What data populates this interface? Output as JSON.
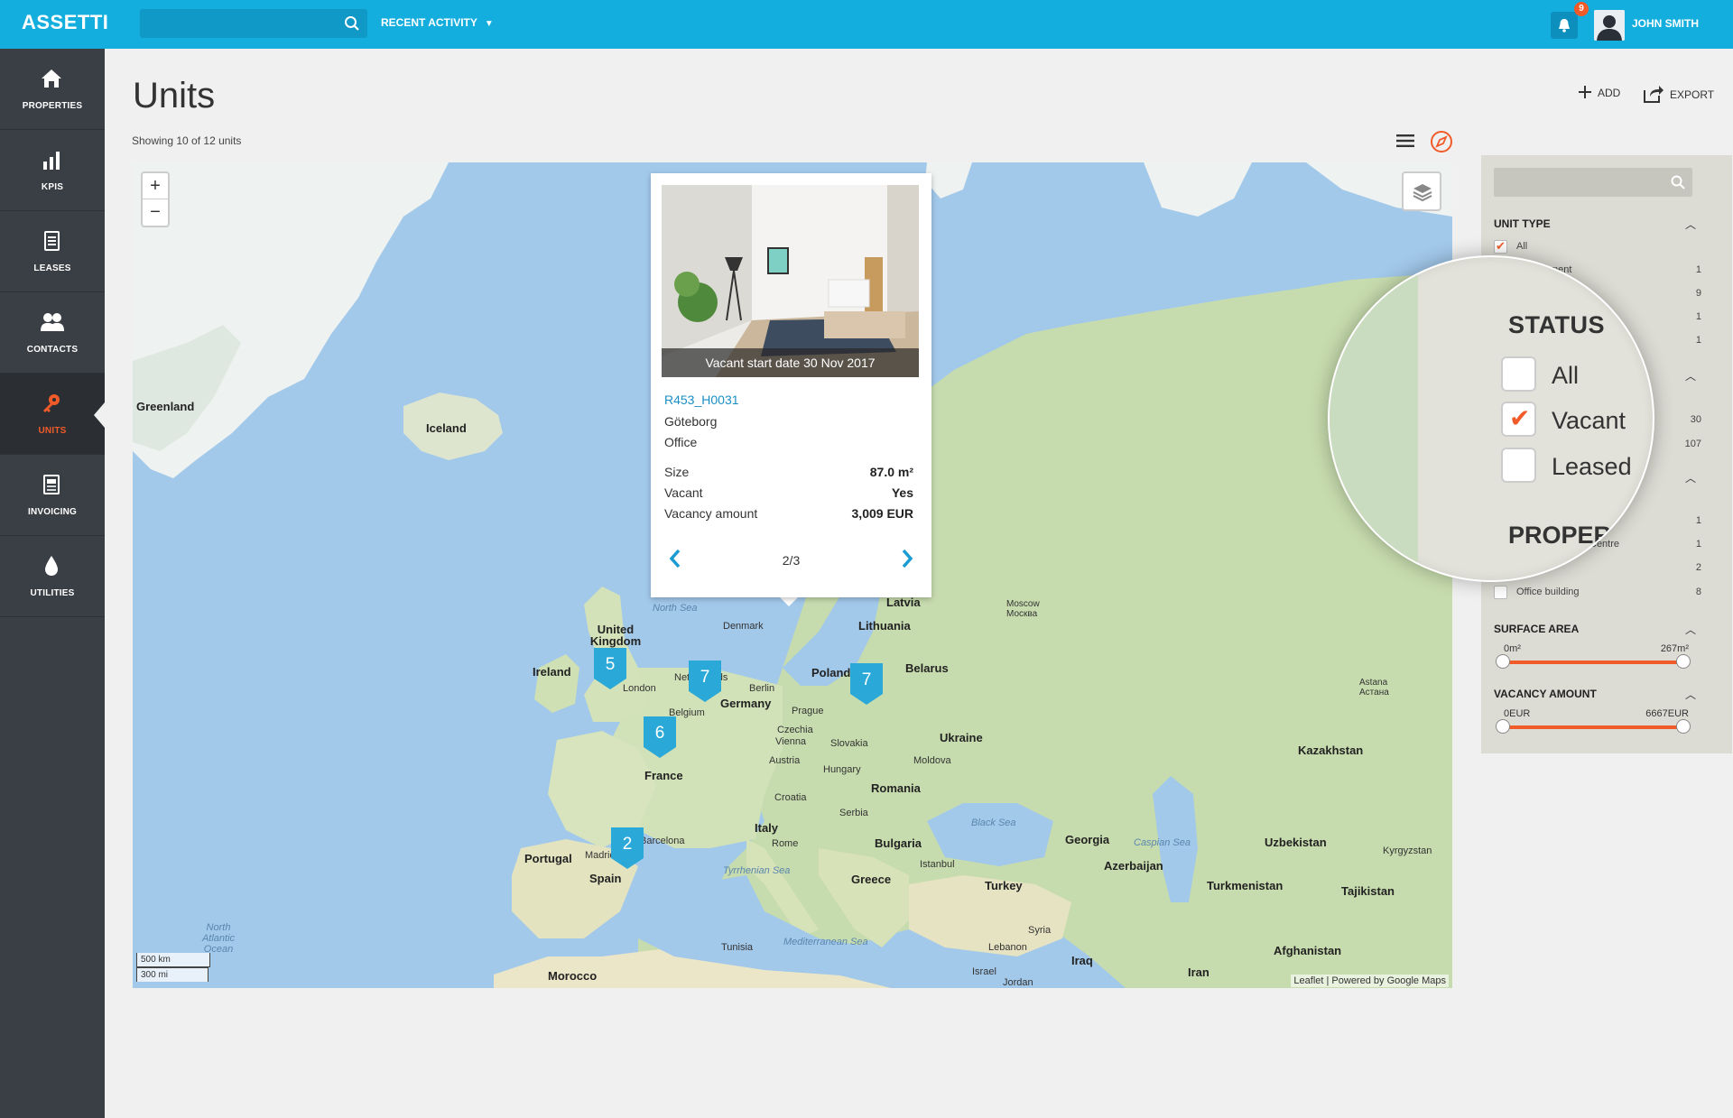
{
  "app": {
    "logo": "ASSETTI"
  },
  "topbar": {
    "recent_activity": "RECENT ACTIVITY",
    "notification_count": "9",
    "user_name": "JOHN SMITH"
  },
  "sidebar": {
    "items": [
      {
        "label": "PROPERTIES",
        "icon": "home-icon"
      },
      {
        "label": "KPIS",
        "icon": "bar-chart-icon"
      },
      {
        "label": "LEASES",
        "icon": "document-icon"
      },
      {
        "label": "CONTACTS",
        "icon": "contacts-icon"
      },
      {
        "label": "UNITS",
        "icon": "key-icon",
        "active": true
      },
      {
        "label": "INVOICING",
        "icon": "invoice-icon"
      },
      {
        "label": "UTILITIES",
        "icon": "drop-icon"
      }
    ]
  },
  "page": {
    "title": "Units",
    "subtitle": "Showing 10 of 12 units",
    "add_label": "ADD",
    "export_label": "EXPORT"
  },
  "map": {
    "zoom_in": "+",
    "zoom_out": "−",
    "scale_km": "500 km",
    "scale_mi": "300 mi",
    "attribution": "Leaflet | Powered by Google Maps",
    "markers": [
      "5",
      "7",
      "7",
      "6",
      "2"
    ],
    "labels": {
      "greenland": "Greenland",
      "iceland": "Iceland",
      "ireland": "Ireland",
      "uk": "United Kingdom",
      "london": "London",
      "netherlands": "Netherlands",
      "belgium": "Belgium",
      "france": "France",
      "spain": "Spain",
      "portugal": "Portugal",
      "madrid": "Madrid",
      "barcelona": "Barcelona",
      "germany": "Germany",
      "berlin": "Berlin",
      "denmark": "Denmark",
      "poland": "Poland",
      "czechia": "Czechia",
      "prague": "Prague",
      "vienna": "Vienna",
      "austria": "Austria",
      "slovakia": "Slovakia",
      "hungary": "Hungary",
      "croatia": "Croatia",
      "serbia": "Serbia",
      "italy": "Italy",
      "rome": "Rome",
      "romania": "Romania",
      "moldova": "Moldova",
      "ukraine": "Ukraine",
      "belarus": "Belarus",
      "lithuania": "Lithuania",
      "latvia": "Latvia",
      "moscow": "Moscow Москва",
      "bulgaria": "Bulgaria",
      "greece": "Greece",
      "istanbul": "Istanbul",
      "turkey": "Turkey",
      "georgia": "Georgia",
      "azerbaijan": "Azerbaijan",
      "kazakhstan": "Kazakhstan",
      "astana": "Astana Астана",
      "uzbekistan": "Uzbekistan",
      "kyrgyzstan": "Kyrgyzstan",
      "turkmenistan": "Turkmenistan",
      "tajikistan": "Tajikistan",
      "afghanistan": "Afghanistan",
      "iran": "Iran",
      "iraq": "Iraq",
      "syria": "Syria",
      "lebanon": "Lebanon",
      "israel": "Israel",
      "jordan": "Jordan",
      "tunisia": "Tunisia",
      "morocco": "Morocco",
      "north_sea": "North Sea",
      "black_sea": "Black Sea",
      "caspian_sea": "Caspian Sea",
      "tyrrhenian": "Tyrrhenian Sea",
      "mediterranean": "Mediterranean Sea",
      "atlantic": "North Atlantic Ocean"
    }
  },
  "popup": {
    "photo_caption": "Vacant start date 30 Nov 2017",
    "unit_id": "R453_H0031",
    "city": "Göteborg",
    "type": "Office",
    "rows": [
      {
        "key": "Size",
        "value": "87.0 m²"
      },
      {
        "key": "Vacant",
        "value": "Yes"
      },
      {
        "key": "Vacancy amount",
        "value": "3,009 EUR"
      }
    ],
    "page": "2/3",
    "close": "×"
  },
  "filters": {
    "unit_type_title": "UNIT TYPE",
    "unit_type_all": "All",
    "unit_type_partial": "ment",
    "unit_type_counts": [
      "1",
      "9",
      "1",
      "1"
    ],
    "status_counts": [
      "30",
      "107"
    ],
    "property_counts": [
      "1",
      "1",
      "2",
      "8"
    ],
    "property_partial": "Centre",
    "office_building": "Office building",
    "surface_title": "SURFACE AREA",
    "surface_min": "0m²",
    "surface_max": "267m²",
    "surface_range": [
      0,
      1
    ],
    "vacancy_title": "VACANCY AMOUNT",
    "vacancy_min": "0EUR",
    "vacancy_max": "6667EUR",
    "vacancy_range": [
      0,
      1
    ]
  },
  "magnifier": {
    "status_title": "STATUS",
    "status_options": [
      {
        "label": "All",
        "checked": false
      },
      {
        "label": "Vacant",
        "checked": true
      },
      {
        "label": "Leased",
        "checked": false
      }
    ],
    "property_title": "PROPERT"
  },
  "colors": {
    "brand": "#13aede",
    "accent": "#f15a29",
    "sidebar": "#3a3f45"
  }
}
